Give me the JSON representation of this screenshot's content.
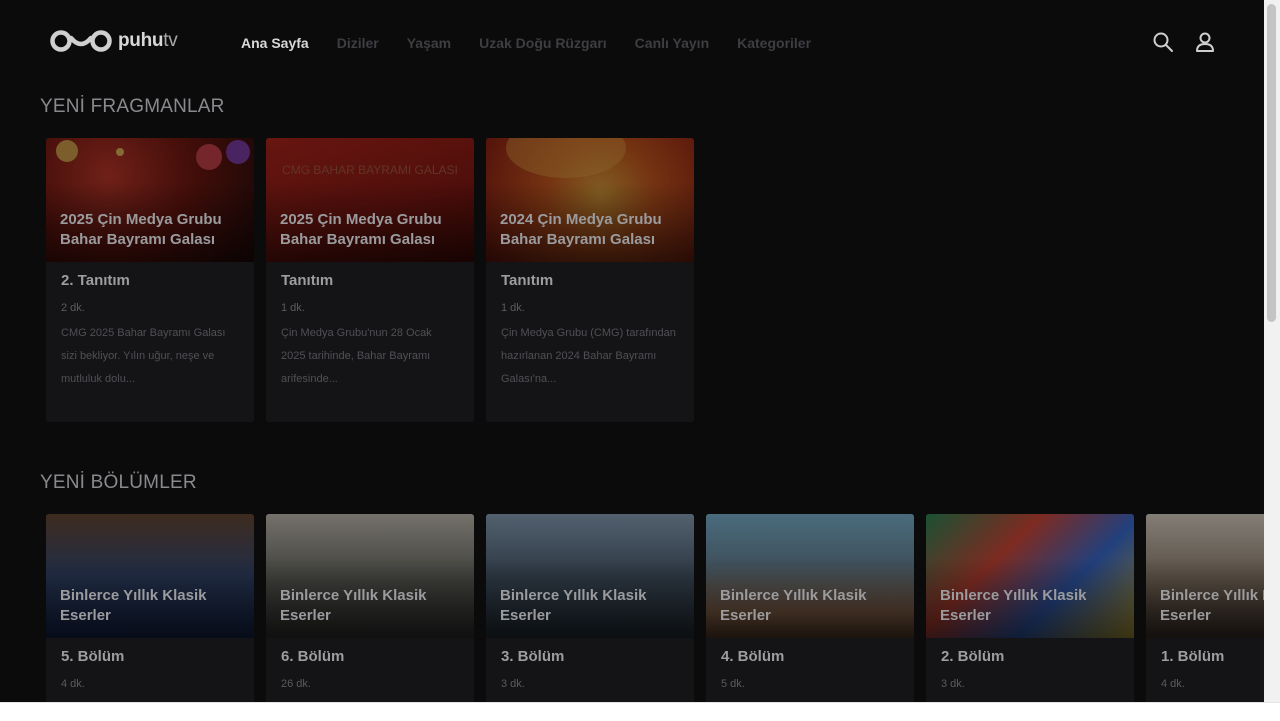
{
  "header": {
    "logo": {
      "brand": "puhu",
      "suffix": "tv"
    },
    "nav": [
      {
        "label": "Ana Sayfa",
        "active": true
      },
      {
        "label": "Diziler",
        "active": false
      },
      {
        "label": "Yaşam",
        "active": false
      },
      {
        "label": "Uzak Doğu Rüzgarı",
        "active": false
      },
      {
        "label": "Canlı Yayın",
        "active": false
      },
      {
        "label": "Kategoriler",
        "active": false
      }
    ],
    "icons": [
      "search-icon",
      "user-icon"
    ]
  },
  "sections": {
    "trailers": {
      "title": "YENİ FRAGMANLAR",
      "cards": [
        {
          "thumb_title": "2025 Çin Medya Grubu Bahar Bayramı Galası",
          "subtitle": "2. Tanıtım",
          "duration": "2 dk.",
          "description": "CMG 2025 Bahar Bayramı Galası sizi bekliyor. Yılın uğur, neşe ve mutluluk dolu..."
        },
        {
          "thumb_title": "2025 Çin Medya Grubu Bahar Bayramı Galası",
          "subtitle": "Tanıtım",
          "duration": "1 dk.",
          "description": "Çin Medya Grubu'nun 28 Ocak 2025 tarihinde, Bahar Bayramı arifesinde...",
          "thumb_text": "CMG BAHAR BAYRAMI GALASI"
        },
        {
          "thumb_title": "2024 Çin Medya Grubu Bahar Bayramı Galası",
          "subtitle": "Tanıtım",
          "duration": "1 dk.",
          "description": "Çin Medya Grubu (CMG) tarafından hazırlanan 2024 Bahar Bayramı Galası'na..."
        }
      ]
    },
    "episodes": {
      "title": "YENİ BÖLÜMLER",
      "cards": [
        {
          "thumb_title": "Binlerce Yıllık Klasik Eserler",
          "subtitle": "5. Bölüm",
          "duration": "4 dk."
        },
        {
          "thumb_title": "Binlerce Yıllık Klasik Eserler",
          "subtitle": "6. Bölüm",
          "duration": "26 dk."
        },
        {
          "thumb_title": "Binlerce Yıllık Klasik Eserler",
          "subtitle": "3. Bölüm",
          "duration": "3 dk."
        },
        {
          "thumb_title": "Binlerce Yıllık Klasik Eserler",
          "subtitle": "4. Bölüm",
          "duration": "5 dk."
        },
        {
          "thumb_title": "Binlerce Yıllık Klasik Eserler",
          "subtitle": "2. Bölüm",
          "duration": "3 dk."
        },
        {
          "thumb_title": "Binlerce Yıllık Klasik Eserler",
          "subtitle": "1. Bölüm",
          "duration": "4 dk."
        }
      ]
    }
  },
  "colors": {
    "background": "#0b0b0c",
    "card": "#141416",
    "active_nav": "#d9d9d9",
    "inactive_nav": "#3e3e42"
  }
}
